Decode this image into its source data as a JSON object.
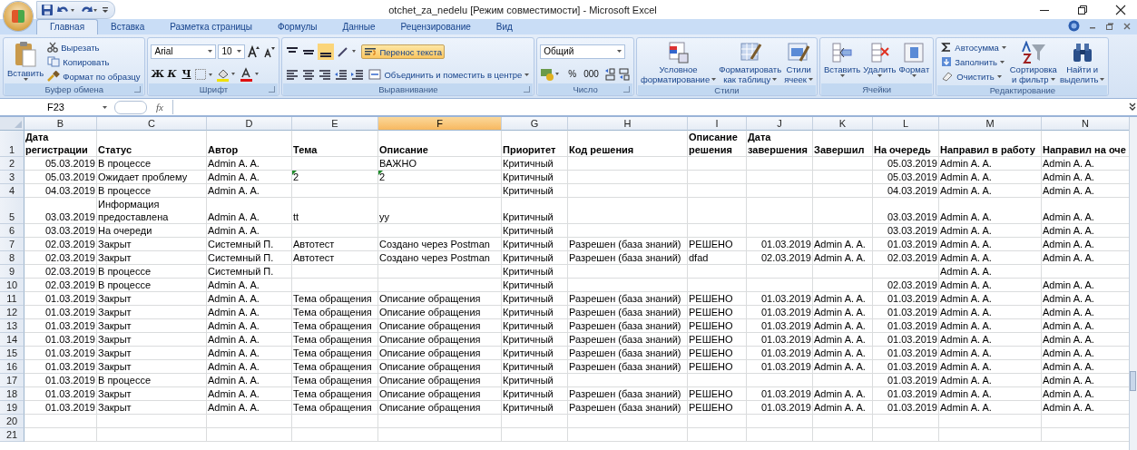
{
  "window": {
    "title": "otchet_za_nedelu  [Режим совместимости] - Microsoft Excel"
  },
  "tabs": [
    {
      "label": "Главная",
      "selected": true
    },
    {
      "label": "Вставка",
      "selected": false
    },
    {
      "label": "Разметка страницы",
      "selected": false
    },
    {
      "label": "Формулы",
      "selected": false
    },
    {
      "label": "Данные",
      "selected": false
    },
    {
      "label": "Рецензирование",
      "selected": false
    },
    {
      "label": "Вид",
      "selected": false
    }
  ],
  "ribbon": {
    "clipboard": {
      "label": "Буфер обмена",
      "paste": "Вставить",
      "items": [
        "Вырезать",
        "Копировать",
        "Формат по образцу"
      ]
    },
    "font": {
      "label": "Шрифт",
      "font_name": "Arial",
      "font_size": "10",
      "bold": "Ж",
      "italic": "К",
      "underline": "Ч"
    },
    "alignment": {
      "label": "Выравнивание",
      "wrap_text": "Перенос текста",
      "wrap_text_on": true,
      "merge": "Объединить и поместить в центре"
    },
    "number": {
      "label": "Число",
      "format": "Общий",
      "percent": "%",
      "thousands": "000"
    },
    "styles": {
      "label": "Стили",
      "items": [
        [
          "Условное",
          "форматирование"
        ],
        [
          "Форматировать",
          "как таблицу"
        ],
        [
          "Стили",
          "ячеек"
        ]
      ]
    },
    "cells": {
      "label": "Ячейки",
      "items": [
        "Вставить",
        "Удалить",
        "Формат"
      ]
    },
    "editing": {
      "label": "Редактирование",
      "small": [
        "Автосумма",
        "Заполнить",
        "Очистить"
      ],
      "large": [
        [
          "Сортировка",
          "и фильтр"
        ],
        [
          "Найти и",
          "выделить"
        ]
      ]
    }
  },
  "formula_bar": {
    "name_box": "F23",
    "function_label": "fx"
  },
  "sheet": {
    "columns": [
      {
        "letter": "B",
        "kind": "date",
        "selected": false
      },
      {
        "letter": "C",
        "kind": "text",
        "selected": false
      },
      {
        "letter": "D",
        "kind": "text",
        "selected": false
      },
      {
        "letter": "E",
        "kind": "text",
        "selected": false
      },
      {
        "letter": "F",
        "kind": "text",
        "selected": true
      },
      {
        "letter": "G",
        "kind": "text",
        "selected": false
      },
      {
        "letter": "H",
        "kind": "text",
        "selected": false
      },
      {
        "letter": "I",
        "kind": "text",
        "selected": false
      },
      {
        "letter": "J",
        "kind": "date",
        "selected": false
      },
      {
        "letter": "K",
        "kind": "text",
        "selected": false
      },
      {
        "letter": "L",
        "kind": "date",
        "selected": false
      },
      {
        "letter": "M",
        "kind": "text",
        "selected": false
      },
      {
        "letter": "N",
        "kind": "text",
        "selected": false
      }
    ],
    "header": {
      "number": "1",
      "cells": [
        "Дата регистрации",
        "Статус",
        "Автор",
        "Тема",
        "Описание",
        "Приоритет",
        "Код решения",
        "Описание решения",
        "Дата завершения",
        "Завершил",
        "На очередь",
        "Направил в работу",
        "Направил на оче"
      ]
    },
    "rows": [
      {
        "number": "2",
        "cells": [
          "05.03.2019",
          "В процессе",
          "Admin A. A.",
          null,
          "ВАЖНО",
          "Критичный",
          null,
          null,
          null,
          null,
          "05.03.2019",
          "Admin A. A.",
          "Admin A. A."
        ]
      },
      {
        "number": "3",
        "warnings": [
          false,
          false,
          false,
          true,
          true,
          false,
          false,
          false,
          false,
          false,
          false,
          false,
          false
        ],
        "cells": [
          "05.03.2019",
          "Ожидает проблему",
          "Admin A. A.",
          "2",
          "2",
          "Критичный",
          null,
          null,
          null,
          null,
          "05.03.2019",
          "Admin A. A.",
          "Admin A. A."
        ]
      },
      {
        "number": "4",
        "cells": [
          "04.03.2019",
          "В процессе",
          "Admin A. A.",
          null,
          null,
          "Критичный",
          null,
          null,
          null,
          null,
          "04.03.2019",
          "Admin A. A.",
          "Admin A. A."
        ]
      },
      {
        "number": "5",
        "cells": [
          "03.03.2019",
          "Информация предоставлена",
          "Admin A. A.",
          "tt",
          "yy",
          "Критичный",
          null,
          null,
          null,
          null,
          "03.03.2019",
          "Admin A. A.",
          "Admin A. A."
        ]
      },
      {
        "number": "6",
        "cells": [
          "03.03.2019",
          "На очереди",
          "Admin A. A.",
          null,
          null,
          "Критичный",
          null,
          null,
          null,
          null,
          "03.03.2019",
          "Admin A. A.",
          "Admin A. A."
        ]
      },
      {
        "number": "7",
        "cells": [
          "02.03.2019",
          "Закрыт",
          "Системный П.",
          "Автотест",
          "Создано через Postman",
          "Критичный",
          "Разрешен (база знаний)",
          "РЕШЕНО",
          "01.03.2019",
          "Admin A. A.",
          "01.03.2019",
          "Admin A. A.",
          "Admin A. A."
        ]
      },
      {
        "number": "8",
        "cells": [
          "02.03.2019",
          "Закрыт",
          "Системный П.",
          "Автотест",
          "Создано через Postman",
          "Критичный",
          "Разрешен (база знаний)",
          "dfad",
          "02.03.2019",
          "Admin A. A.",
          "02.03.2019",
          "Admin A. A.",
          "Admin A. A."
        ]
      },
      {
        "number": "9",
        "cells": [
          "02.03.2019",
          "В процессе",
          "Системный П.",
          null,
          null,
          "Критичный",
          null,
          null,
          null,
          null,
          null,
          "Admin A. A.",
          null
        ]
      },
      {
        "number": "10",
        "cells": [
          "02.03.2019",
          "В процессе",
          "Admin A. A.",
          null,
          null,
          "Критичный",
          null,
          null,
          null,
          null,
          "02.03.2019",
          "Admin A. A.",
          "Admin A. A."
        ]
      },
      {
        "number": "11",
        "cells": [
          "01.03.2019",
          "Закрыт",
          "Admin A. A.",
          "Тема обращения",
          "Описание обращения",
          "Критичный",
          "Разрешен (база знаний)",
          "РЕШЕНО",
          "01.03.2019",
          "Admin A. A.",
          "01.03.2019",
          "Admin A. A.",
          "Admin A. A."
        ]
      },
      {
        "number": "12",
        "cells": [
          "01.03.2019",
          "Закрыт",
          "Admin A. A.",
          "Тема обращения",
          "Описание обращения",
          "Критичный",
          "Разрешен (база знаний)",
          "РЕШЕНО",
          "01.03.2019",
          "Admin A. A.",
          "01.03.2019",
          "Admin A. A.",
          "Admin A. A."
        ]
      },
      {
        "number": "13",
        "cells": [
          "01.03.2019",
          "Закрыт",
          "Admin A. A.",
          "Тема обращения",
          "Описание обращения",
          "Критичный",
          "Разрешен (база знаний)",
          "РЕШЕНО",
          "01.03.2019",
          "Admin A. A.",
          "01.03.2019",
          "Admin A. A.",
          "Admin A. A."
        ]
      },
      {
        "number": "14",
        "cells": [
          "01.03.2019",
          "Закрыт",
          "Admin A. A.",
          "Тема обращения",
          "Описание обращения",
          "Критичный",
          "Разрешен (база знаний)",
          "РЕШЕНО",
          "01.03.2019",
          "Admin A. A.",
          "01.03.2019",
          "Admin A. A.",
          "Admin A. A."
        ]
      },
      {
        "number": "15",
        "cells": [
          "01.03.2019",
          "Закрыт",
          "Admin A. A.",
          "Тема обращения",
          "Описание обращения",
          "Критичный",
          "Разрешен (база знаний)",
          "РЕШЕНО",
          "01.03.2019",
          "Admin A. A.",
          "01.03.2019",
          "Admin A. A.",
          "Admin A. A."
        ]
      },
      {
        "number": "16",
        "cells": [
          "01.03.2019",
          "Закрыт",
          "Admin A. A.",
          "Тема обращения",
          "Описание обращения",
          "Критичный",
          "Разрешен (база знаний)",
          "РЕШЕНО",
          "01.03.2019",
          "Admin A. A.",
          "01.03.2019",
          "Admin A. A.",
          "Admin A. A."
        ]
      },
      {
        "number": "17",
        "cells": [
          "01.03.2019",
          "В процессе",
          "Admin A. A.",
          "Тема обращения",
          "Описание обращения",
          "Критичный",
          null,
          null,
          null,
          null,
          "01.03.2019",
          "Admin A. A.",
          "Admin A. A."
        ]
      },
      {
        "number": "18",
        "cells": [
          "01.03.2019",
          "Закрыт",
          "Admin A. A.",
          "Тема обращения",
          "Описание обращения",
          "Критичный",
          "Разрешен (база знаний)",
          "РЕШЕНО",
          "01.03.2019",
          "Admin A. A.",
          "01.03.2019",
          "Admin A. A.",
          "Admin A. A."
        ]
      },
      {
        "number": "19",
        "cells": [
          "01.03.2019",
          "Закрыт",
          "Admin A. A.",
          "Тема обращения",
          "Описание обращения",
          "Критичный",
          "Разрешен (база знаний)",
          "РЕШЕНО",
          "01.03.2019",
          "Admin A. A.",
          "01.03.2019",
          "Admin A. A.",
          "Admin A. A."
        ]
      },
      {
        "number": "20"
      },
      {
        "number": "21"
      }
    ]
  }
}
